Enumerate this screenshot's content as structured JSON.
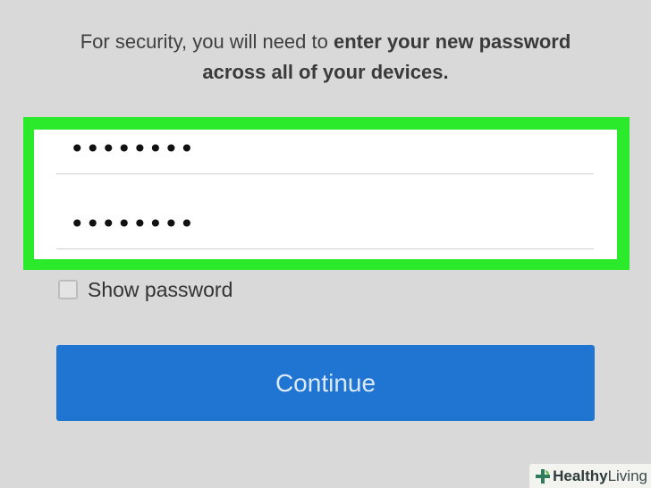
{
  "notice": {
    "text_regular": "For security, you will need to ",
    "text_bold": "enter your new password across all of your devices."
  },
  "fields": {
    "new_password_masked": "••••••••",
    "confirm_password_masked": "••••••••"
  },
  "show_password": {
    "label": "Show password",
    "checked": false
  },
  "continue_button": {
    "label": "Continue"
  },
  "watermark": {
    "brand_bold": "Healthy",
    "brand_light": "Living",
    "logo_icon": "plus-leaf-icon"
  },
  "colors": {
    "background": "#d9d9d9",
    "highlight": "#2bea2b",
    "button": "#1f75d1",
    "button_text": "#dbe9fb"
  }
}
